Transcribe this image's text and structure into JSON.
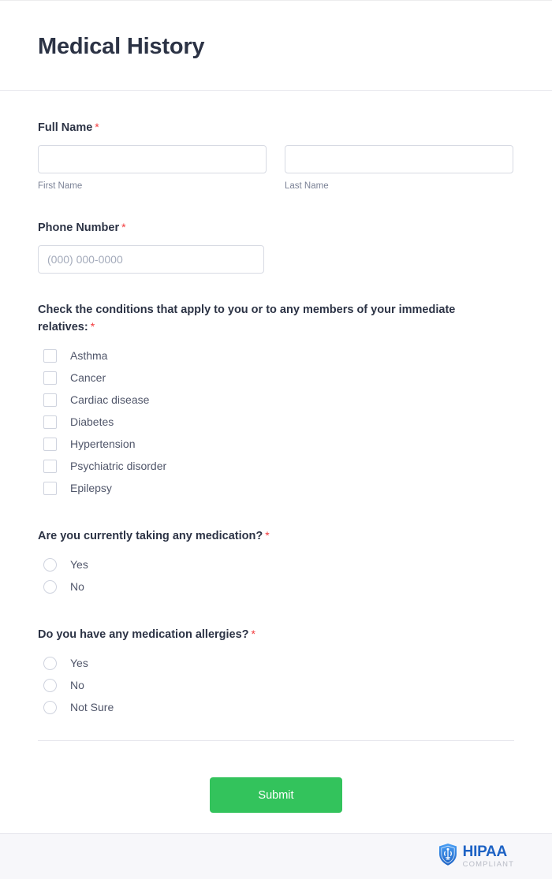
{
  "header": {
    "title": "Medical History"
  },
  "fields": {
    "full_name": {
      "label": "Full Name",
      "required_marker": "*",
      "first": {
        "placeholder": "",
        "value": "",
        "sub_label": "First Name"
      },
      "last": {
        "placeholder": "",
        "value": "",
        "sub_label": "Last Name"
      }
    },
    "phone": {
      "label": "Phone Number",
      "required_marker": "*",
      "placeholder": "(000) 000-0000",
      "value": ""
    },
    "conditions": {
      "label": "Check the conditions that apply to you or to any members of your immediate relatives:",
      "required_marker": "*",
      "options": [
        "Asthma",
        "Cancer",
        "Cardiac disease",
        "Diabetes",
        "Hypertension",
        "Psychiatric disorder",
        "Epilepsy"
      ]
    },
    "medication": {
      "label": "Are you currently taking any medication?",
      "required_marker": "*",
      "options": [
        "Yes",
        "No"
      ]
    },
    "allergies": {
      "label": "Do you have any medication allergies?",
      "required_marker": "*",
      "options": [
        "Yes",
        "No",
        "Not Sure"
      ]
    }
  },
  "submit": {
    "label": "Submit"
  },
  "footer": {
    "badge": {
      "icon": "shield-caduceus-icon",
      "main_text": "HIPAA",
      "sub_text": "COMPLIANT"
    }
  },
  "colors": {
    "title": "#2c3345",
    "required": "#f23a3c",
    "submit_bg": "#33c35c",
    "hipaa_blue": "#1d62c4",
    "border": "#d7dae3"
  }
}
